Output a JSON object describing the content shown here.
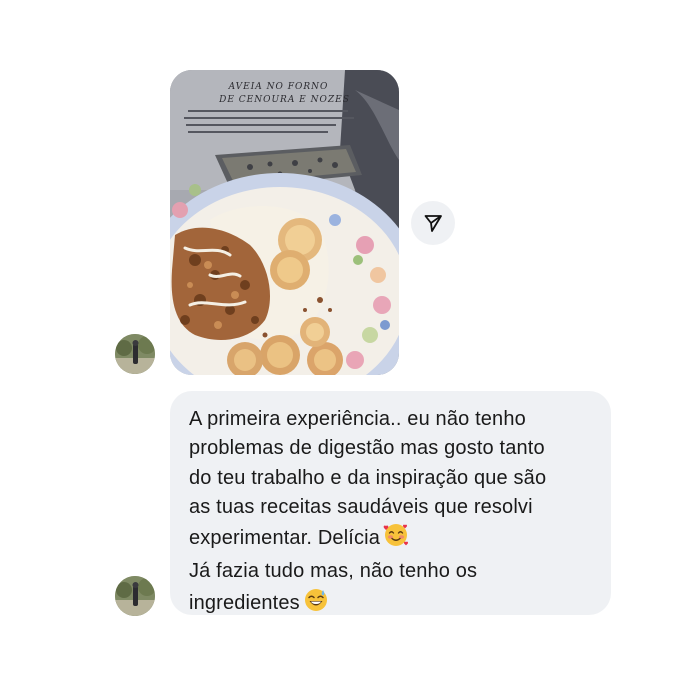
{
  "thread": {
    "image_message": {
      "book_title_line1": "AVEIA NO FORNO",
      "book_title_line2": "DE CENOURA E NOZES"
    },
    "text_message": {
      "lines": [
        "A primeira experiência.. eu não tenho",
        "problemas de digestão mas gosto tanto",
        "do teu trabalho e da inspiração que são",
        "as tuas receitas saudáveis que resolvi",
        "experimentar. Delícia",
        "Já fazia tudo mas, não tenho os",
        "ingredientes"
      ],
      "emoji_1": "smiling-face-with-hearts",
      "emoji_2": "grinning-face-with-sweat"
    },
    "icons": {
      "share": "send-icon"
    }
  },
  "colors": {
    "bubble_background": "#eff1f4",
    "text": "#1a1a1a",
    "page_background": "#ffffff"
  }
}
